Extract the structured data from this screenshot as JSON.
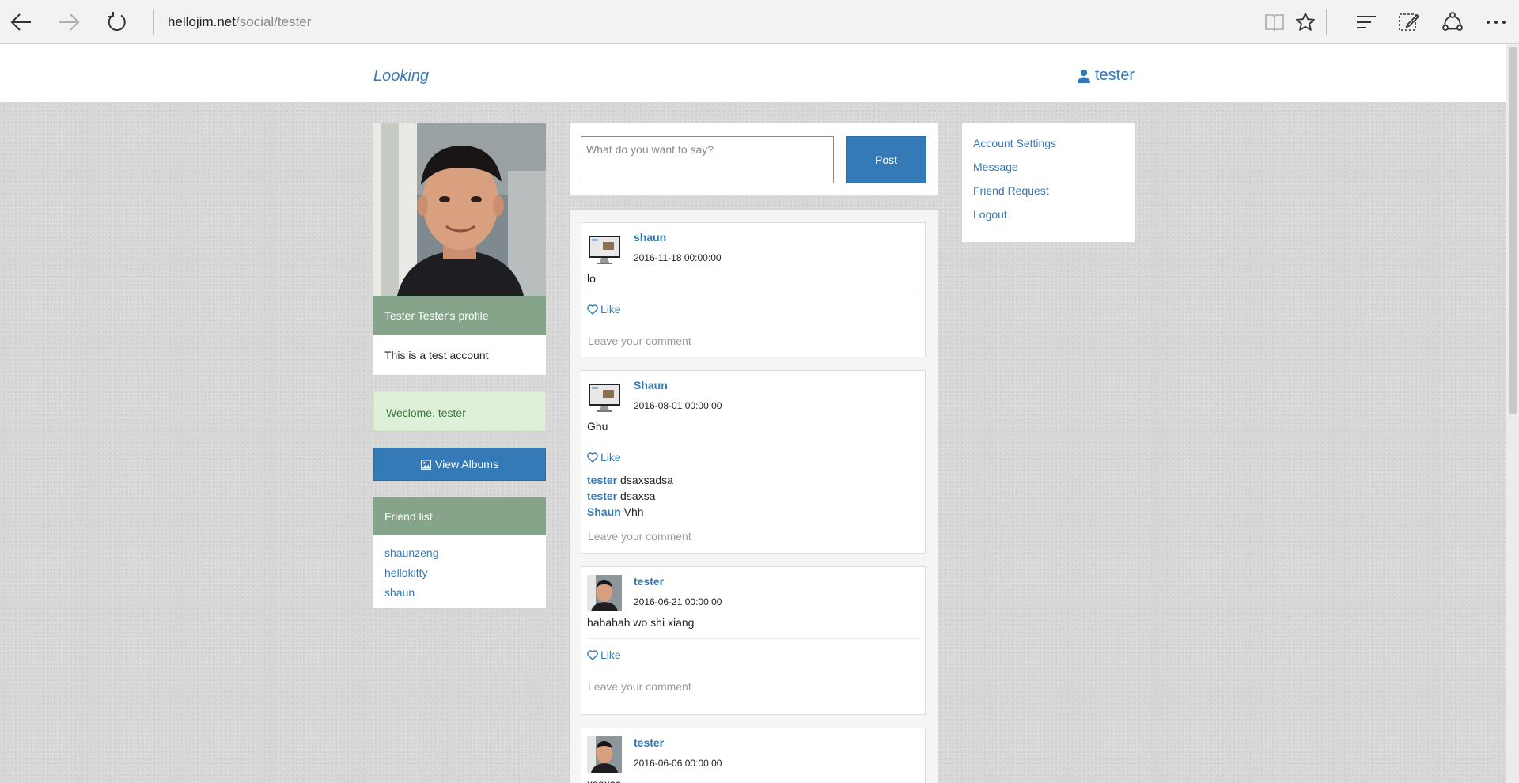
{
  "browser": {
    "url_host": "hellojim.net",
    "url_path": "/social/tester"
  },
  "header": {
    "brand": "Looking",
    "username": "tester"
  },
  "profile": {
    "title": "Tester Tester's profile",
    "bio": "This is a test account",
    "welcome": "Weclome, tester",
    "albums_label": "View Albums",
    "friends_heading": "Friend list",
    "friends": [
      "shaunzeng",
      "hellokitty",
      "shaun"
    ]
  },
  "composer": {
    "placeholder": "What do you want to say?",
    "post_label": "Post"
  },
  "feed": {
    "like_label": "Like",
    "comment_placeholder": "Leave your comment",
    "posts": [
      {
        "author": "shaun",
        "timestamp": "2016-11-18 00:00:00",
        "content": "lo",
        "comments": []
      },
      {
        "author": "Shaun",
        "timestamp": "2016-08-01 00:00:00",
        "content": "Ghu",
        "comments": [
          {
            "author": "tester",
            "text": "dsaxsadsa"
          },
          {
            "author": "tester",
            "text": "dsaxsa"
          },
          {
            "author": "Shaun",
            "text": "Vhh"
          }
        ]
      },
      {
        "author": "tester",
        "timestamp": "2016-06-21 00:00:00",
        "content": "hahahah wo shi xiang",
        "comments": []
      },
      {
        "author": "tester",
        "timestamp": "2016-06-06 00:00:00",
        "content": "xsaxsa",
        "comments": []
      }
    ]
  },
  "menu": {
    "items": [
      "Account Settings",
      "Message",
      "Friend Request",
      "Logout"
    ]
  }
}
